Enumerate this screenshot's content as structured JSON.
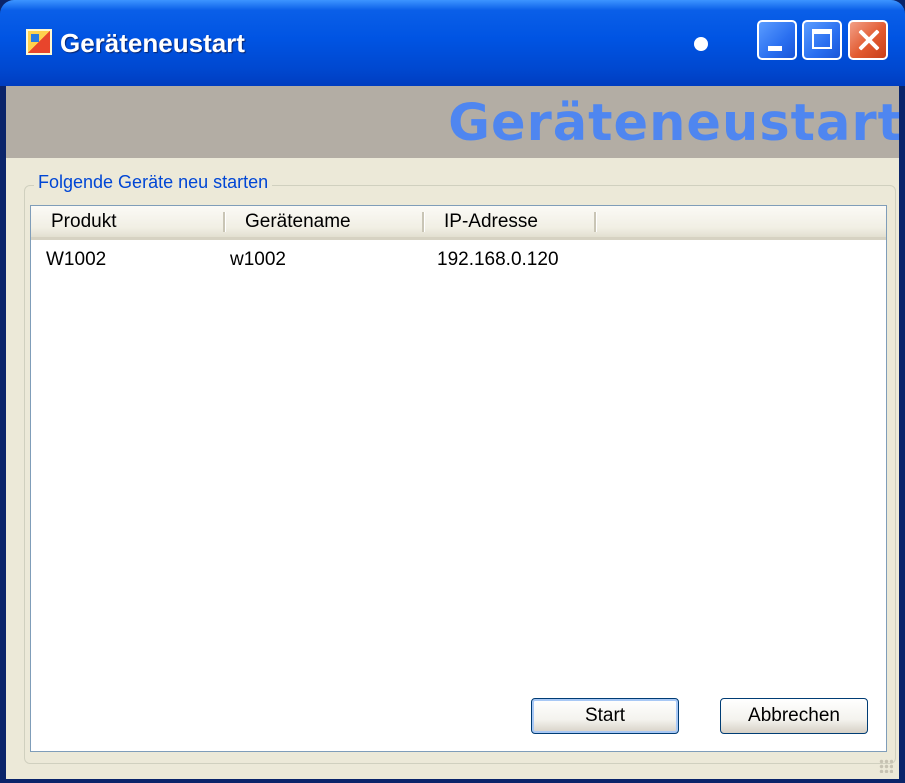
{
  "window": {
    "title": "Geräteneustart",
    "app_icon": "app-icon",
    "controls": [
      "minimize-icon",
      "maximize-icon",
      "close-icon"
    ]
  },
  "banner": {
    "title": "Geräteneustart"
  },
  "group": {
    "label": "Folgende Geräte neu starten"
  },
  "table": {
    "columns": [
      "Produkt",
      "Gerätename",
      "IP-Adresse"
    ],
    "rows": [
      {
        "product": "W1002",
        "device_name": "w1002",
        "ip": "192.168.0.120"
      }
    ]
  },
  "buttons": {
    "start": "Start",
    "cancel": "Abbrechen"
  },
  "colors": {
    "titlebar": "#0054e3",
    "banner_text": "#4f86f0",
    "group_label": "#0046d5",
    "client": "#ece9d8"
  }
}
